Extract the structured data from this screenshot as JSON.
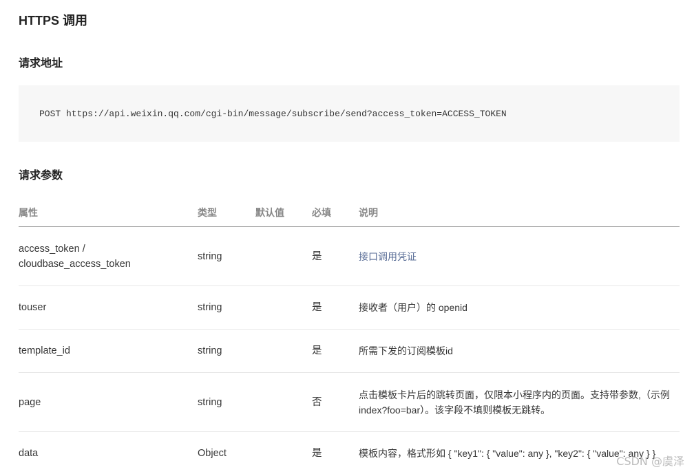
{
  "title": "HTTPS 调用",
  "request_address": {
    "heading": "请求地址",
    "code": "POST https://api.weixin.qq.com/cgi-bin/message/subscribe/send?access_token=ACCESS_TOKEN"
  },
  "request_params": {
    "heading": "请求参数",
    "headers": [
      "属性",
      "类型",
      "默认值",
      "必填",
      "说明"
    ],
    "rows": [
      {
        "name_line1": "access_token /",
        "name_line2": "cloudbase_access_token",
        "type": "string",
        "default": "",
        "required": "是",
        "description": "接口调用凭证"
      },
      {
        "name": "touser",
        "type": "string",
        "default": "",
        "required": "是",
        "description": "接收者（用户）的 openid"
      },
      {
        "name": "template_id",
        "type": "string",
        "default": "",
        "required": "是",
        "description": "所需下发的订阅模板id"
      },
      {
        "name": "page",
        "type": "string",
        "default": "",
        "required": "否",
        "description_line1": "点击模板卡片后的跳转页面，仅限本小程序内的页面。支持带参数,（示例",
        "description_line2": "index?foo=bar）。该字段不填则模板无跳转。"
      },
      {
        "name": "data",
        "type": "Object",
        "default": "",
        "required": "是",
        "description": "模板内容，格式形如 { \"key1\": { \"value\": any }, \"key2\": { \"value\": any } }"
      }
    ]
  },
  "watermark": "CSDN @虞泽",
  "colors": {
    "link": "#576b95",
    "code_bg": "#f7f7f7",
    "header_text": "#888888"
  }
}
